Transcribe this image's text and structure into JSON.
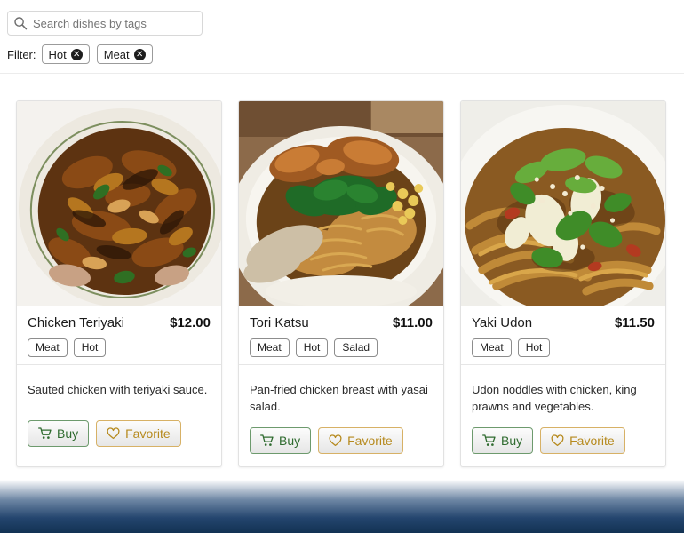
{
  "search": {
    "placeholder": "Search dishes by tags",
    "value": "",
    "icon": "search-icon"
  },
  "filter": {
    "label": "Filter:",
    "chips": [
      {
        "label": "Hot",
        "remove_icon": "close-circle-icon",
        "remove_glyph": "✕"
      },
      {
        "label": "Meat",
        "remove_icon": "close-circle-icon",
        "remove_glyph": "✕"
      }
    ]
  },
  "colors": {
    "buy_text": "#2f6b2f",
    "buy_border": "#6d9a6d",
    "favorite_text": "#b68a1e",
    "favorite_border": "#d7b166",
    "chip_border": "#9b9b9b",
    "footer_gradient_end": "#123253"
  },
  "actions": {
    "buy_label": "Buy",
    "buy_icon": "shopping-cart-icon",
    "favorite_label": "Favorite",
    "favorite_icon": "heart-outline-icon"
  },
  "cards": [
    {
      "name": "Chicken Teriyaki",
      "price": "$12.00",
      "tags": [
        "Meat",
        "Hot"
      ],
      "description": "Sauted chicken with teriyaki sauce.",
      "photo_alt": "chicken-teriyaki-photo"
    },
    {
      "name": "Tori Katsu",
      "price": "$11.00",
      "tags": [
        "Meat",
        "Hot",
        "Salad"
      ],
      "description": "Pan-fried chicken breast with yasai salad.",
      "photo_alt": "tori-katsu-photo"
    },
    {
      "name": "Yaki Udon",
      "price": "$11.50",
      "tags": [
        "Meat",
        "Hot"
      ],
      "description": "Udon noddles with chicken, king prawns and vegetables.",
      "photo_alt": "yaki-udon-photo"
    }
  ]
}
